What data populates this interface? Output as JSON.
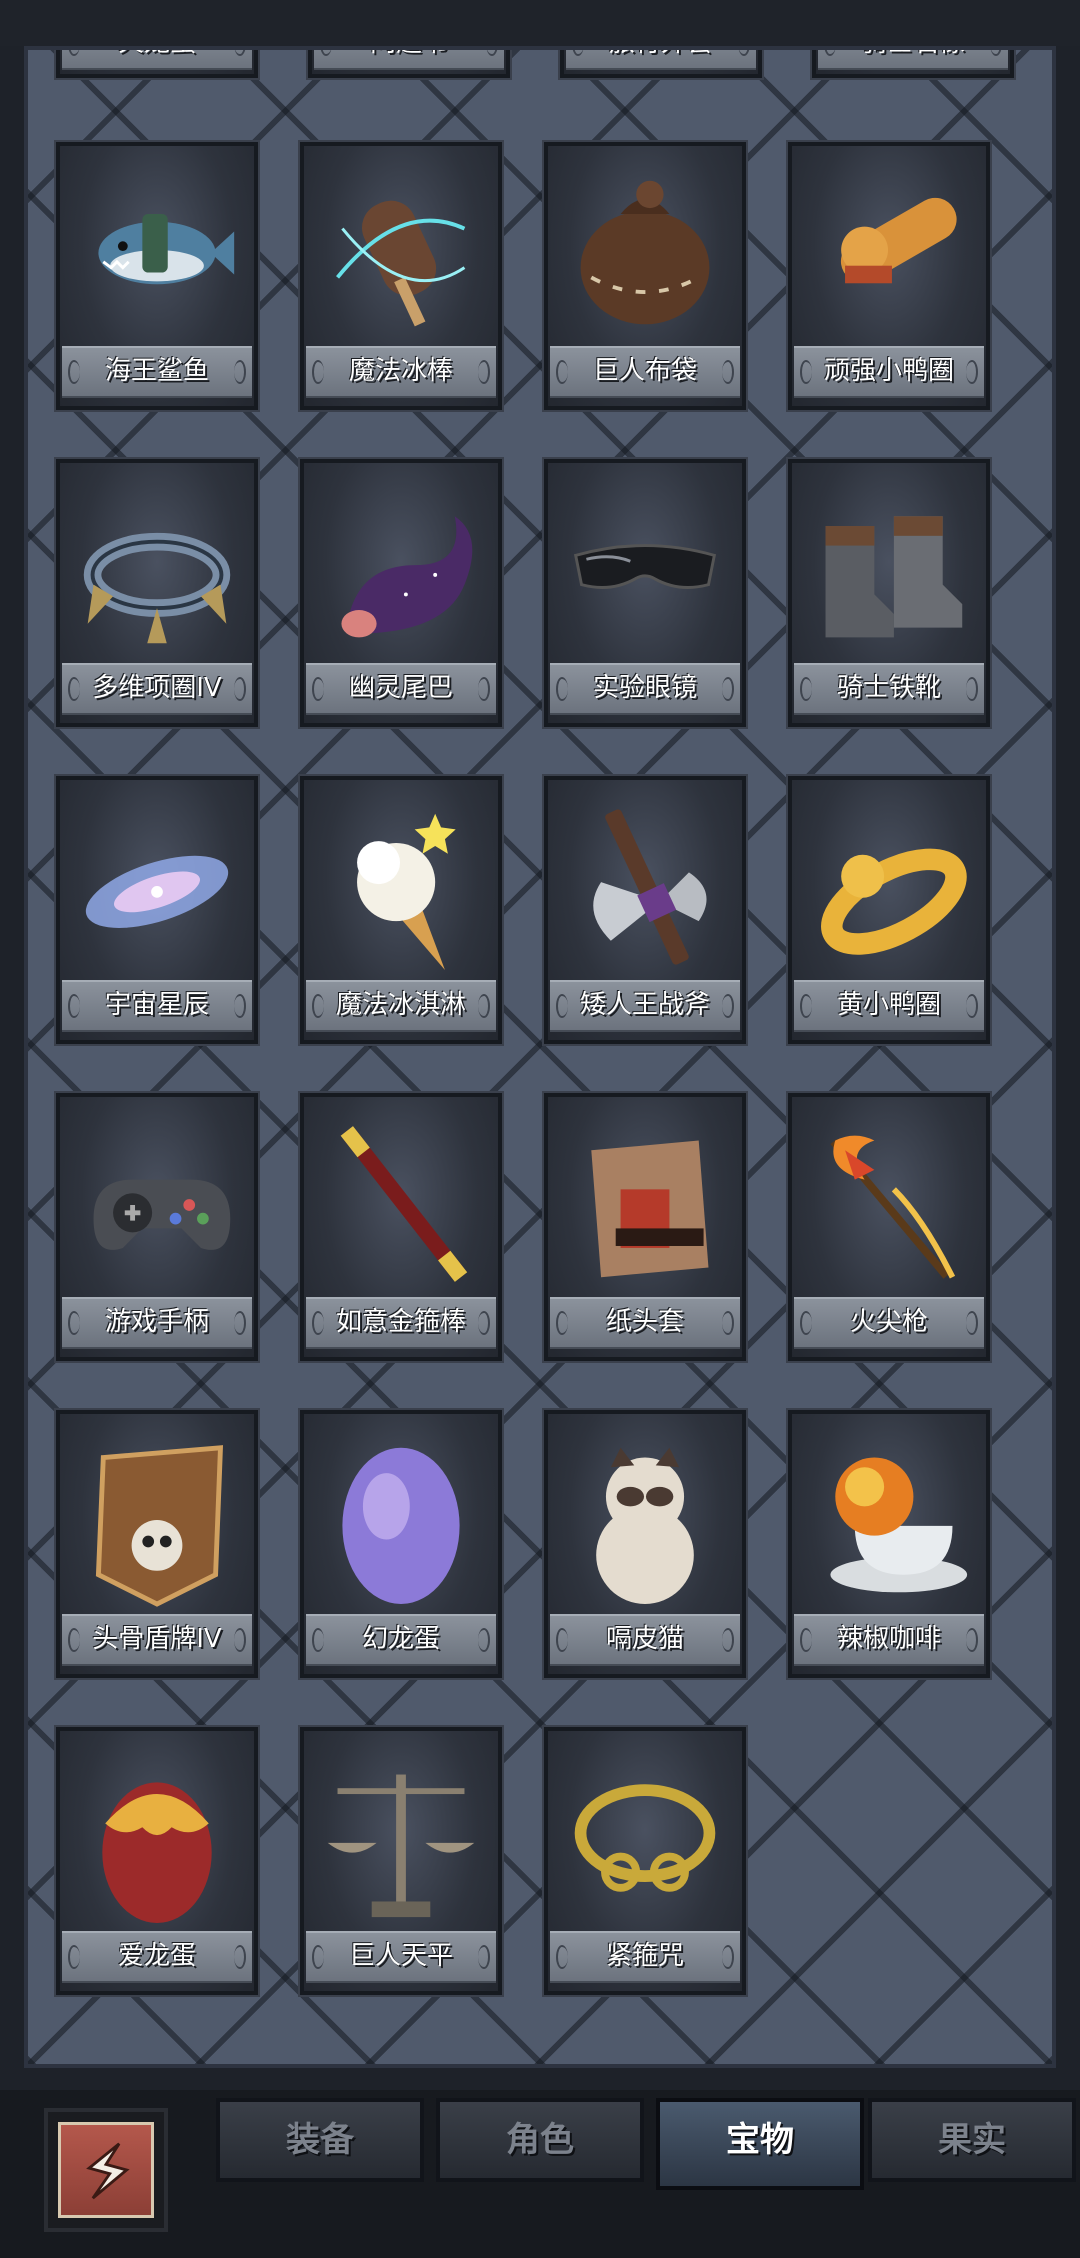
{
  "partial_row": [
    "火龙蛋",
    "问题书",
    "旅行外套",
    "骑士石像"
  ],
  "items": [
    {
      "name": "海王鲨鱼",
      "icon": "shark-fish-icon"
    },
    {
      "name": "魔法冰棒",
      "icon": "ice-pop-icon"
    },
    {
      "name": "巨人布袋",
      "icon": "sack-icon"
    },
    {
      "name": "顽强小鸭圈",
      "icon": "duck-ring-icon"
    },
    {
      "name": "多维项圈IV",
      "icon": "spiked-collar-icon"
    },
    {
      "name": "幽灵尾巴",
      "icon": "ghost-tail-icon"
    },
    {
      "name": "实验眼镜",
      "icon": "goggles-icon"
    },
    {
      "name": "骑士铁靴",
      "icon": "iron-boots-icon"
    },
    {
      "name": "宇宙星辰",
      "icon": "galaxy-icon"
    },
    {
      "name": "魔法冰淇淋",
      "icon": "ice-cream-icon"
    },
    {
      "name": "矮人王战斧",
      "icon": "battle-axe-icon"
    },
    {
      "name": "黄小鸭圈",
      "icon": "yellow-duck-ring-icon"
    },
    {
      "name": "游戏手柄",
      "icon": "gamepad-icon"
    },
    {
      "name": "如意金箍棒",
      "icon": "golden-staff-icon"
    },
    {
      "name": "纸头套",
      "icon": "paper-bag-mask-icon"
    },
    {
      "name": "火尖枪",
      "icon": "fire-spear-icon"
    },
    {
      "name": "头骨盾牌IV",
      "icon": "skull-shield-icon"
    },
    {
      "name": "幻龙蛋",
      "icon": "purple-dragon-egg-icon"
    },
    {
      "name": "嗝皮猫",
      "icon": "cat-icon"
    },
    {
      "name": "辣椒咖啡",
      "icon": "chili-coffee-icon"
    },
    {
      "name": "爱龙蛋",
      "icon": "red-dragon-egg-icon"
    },
    {
      "name": "巨人天平",
      "icon": "scales-icon"
    },
    {
      "name": "紧箍咒",
      "icon": "golden-circlet-icon"
    }
  ],
  "tabs": [
    {
      "label": "装备",
      "active": false
    },
    {
      "label": "角色",
      "active": false
    },
    {
      "label": "宝物",
      "active": true
    },
    {
      "label": "果实",
      "active": false
    }
  ],
  "back_button": {
    "icon": "return-arrow-icon"
  },
  "colors": {
    "board": "#505a6c",
    "label": "#7a818b",
    "active_tab": "#3c4a5c"
  }
}
